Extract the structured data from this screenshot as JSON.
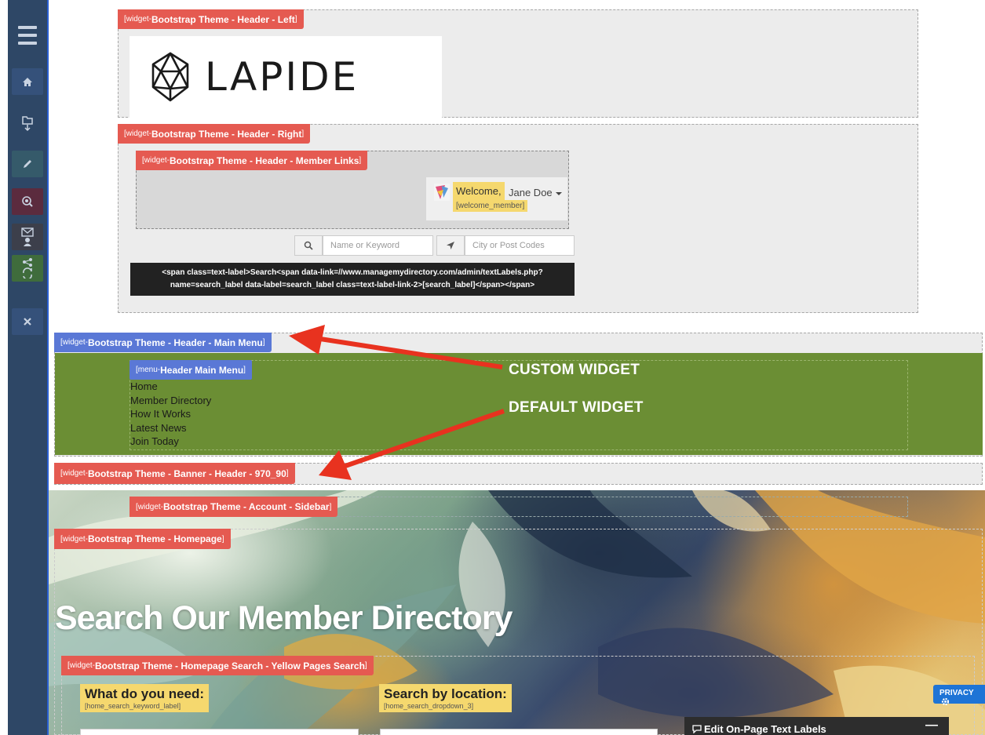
{
  "widgets": {
    "header_left": {
      "prefix": "[widget-",
      "name": "Bootstrap Theme - Header - Left",
      "suffix": "]"
    },
    "header_right": {
      "prefix": "[widget-",
      "name": "Bootstrap Theme - Header - Right",
      "suffix": "]"
    },
    "member_links": {
      "prefix": "[widget-",
      "name": "Bootstrap Theme - Header - Member Links",
      "suffix": "]"
    },
    "main_menu": {
      "prefix": "[widget-",
      "name": "Bootstrap Theme - Header - Main Menu",
      "suffix": "]"
    },
    "menu_header": {
      "prefix": "[menu-",
      "name": "Header Main Menu",
      "suffix": "]"
    },
    "banner_header": {
      "prefix": "[widget-",
      "name": "Bootstrap Theme - Banner - Header - 970_90",
      "suffix": "]"
    },
    "account_sidebar": {
      "prefix": "[widget-",
      "name": "Bootstrap Theme - Account - Sidebar",
      "suffix": "]"
    },
    "homepage": {
      "prefix": "[widget-",
      "name": "Bootstrap Theme - Homepage",
      "suffix": "]"
    },
    "homepage_search": {
      "prefix": "[widget-",
      "name": "Bootstrap Theme - Homepage Search - Yellow Pages Search",
      "suffix": "]"
    }
  },
  "logo": {
    "text": "LAPIDE"
  },
  "member": {
    "welcome": "Welcome,",
    "name": "Jane Doe",
    "code": "[welcome_member]"
  },
  "search": {
    "keyword_placeholder": "Name or Keyword",
    "location_placeholder": "City or Post Codes"
  },
  "code_snippet": {
    "line1": "<span class=text-label>Search<span data-link=//www.managemydirectory.com/admin/textLabels.php?",
    "line2": "name=search_label data-label=search_label class=text-label-link-2>[search_label]</span></span>"
  },
  "menu": {
    "items": [
      "Home",
      "Member Directory",
      "How It Works",
      "Latest News",
      "Join Today"
    ]
  },
  "annotations": {
    "custom": "CUSTOM WIDGET",
    "default": "DEFAULT WIDGET"
  },
  "hero": {
    "title": "Search Our Member Directory"
  },
  "search_labels": {
    "need": "What do you need:",
    "need_code": "[home_search_keyword_label]",
    "location": "Search by location:",
    "location_code": "[home_search_dropdown_3]"
  },
  "privacy": {
    "label": "PRIVACY"
  },
  "edit_panel": {
    "title": "Edit On-Page Text Labels"
  },
  "colors": {
    "sidebar": "#2e4766",
    "tag_red": "#e55a51",
    "tag_blue": "#5a78d6",
    "menu_green": "#6b8e34",
    "label_yellow": "#f5d86e",
    "arrow_red": "#e8321f"
  }
}
